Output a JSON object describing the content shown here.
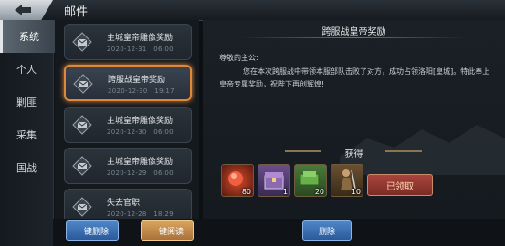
{
  "header": {
    "title": "邮件",
    "back_icon": "back-arrow-icon"
  },
  "sidebar": {
    "items": [
      {
        "label": "系统",
        "active": true
      },
      {
        "label": "个人",
        "active": false
      },
      {
        "label": "剿匪",
        "active": false
      },
      {
        "label": "采集",
        "active": false
      },
      {
        "label": "国战",
        "active": false
      }
    ]
  },
  "mails": [
    {
      "title": "主城皇帝雕像奖励",
      "date": "2020-12-31",
      "time": "06:00",
      "selected": false
    },
    {
      "title": "跨服战皇帝奖励",
      "date": "2020-12-30",
      "time": "19:17",
      "selected": true
    },
    {
      "title": "主城皇帝雕像奖励",
      "date": "2020-12-30",
      "time": "06:00",
      "selected": false
    },
    {
      "title": "主城皇帝雕像奖励",
      "date": "2020-12-29",
      "time": "06:00",
      "selected": false
    },
    {
      "title": "失去官职",
      "date": "2020-12-28",
      "time": "18:29",
      "selected": false
    }
  ],
  "detail": {
    "title": "跨服战皇帝奖励",
    "greeting": "尊敬的主公:",
    "body": "您在本次跨服战中带领本服部队击败了对方，成功占领洛阳[皇城]。特此奉上皇帝专属奖励，祝陛下再创辉煌!",
    "gain_label": "获得",
    "rewards": [
      {
        "icon": "red-orb-icon",
        "count": "80",
        "color": "#7a2a1a"
      },
      {
        "icon": "treasure-chest-icon",
        "count": "1",
        "color": "#4a3a6a"
      },
      {
        "icon": "stone-bundle-icon",
        "count": "20",
        "color": "#2f5a2a"
      },
      {
        "icon": "warrior-icon",
        "count": "10",
        "color": "#4a3522"
      }
    ],
    "claimed_label": "已领取"
  },
  "buttons": {
    "delete_all": "一键删除",
    "read_all": "一键阅读",
    "delete": "删除"
  },
  "colors": {
    "selected_border": "#e0873a",
    "blue_button": "#3a6db0",
    "orange_button": "#c58b4a",
    "claimed": "#8f3630"
  }
}
